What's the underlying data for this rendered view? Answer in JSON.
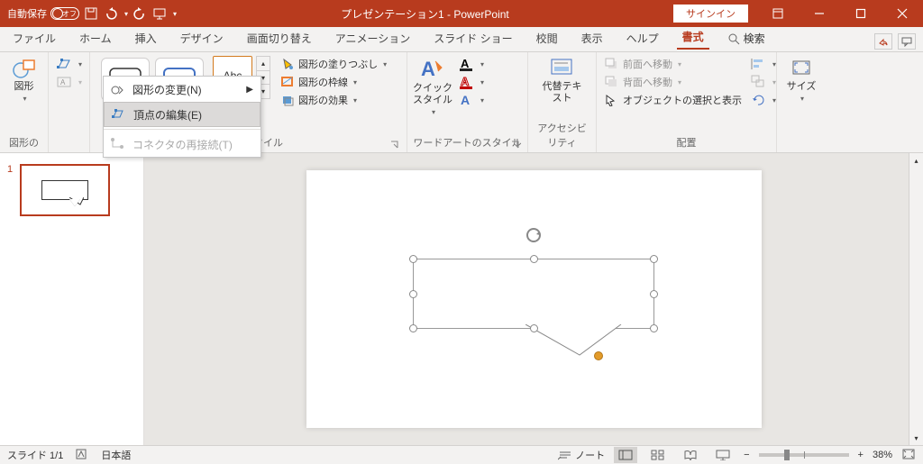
{
  "title_bar": {
    "autosave_label": "自動保存",
    "autosave_state": "オフ",
    "document_title": "プレゼンテーション1 - PowerPoint",
    "sign_in": "サインイン"
  },
  "tabs": {
    "items": [
      "ファイル",
      "ホーム",
      "挿入",
      "デザイン",
      "画面切り替え",
      "アニメーション",
      "スライド ショー",
      "校閲",
      "表示",
      "ヘルプ",
      "書式"
    ],
    "search": "検索",
    "active": "書式"
  },
  "ribbon": {
    "shapes": {
      "label": "図形",
      "group_label": "図形の"
    },
    "styles_group": "図形のスタイル",
    "abc": "Abc",
    "fill": "図形の塗りつぶし",
    "outline": "図形の枠線",
    "effects": "図形の効果",
    "quick_styles": "クイック スタイル",
    "wordart_group": "ワードアートのスタイル",
    "alt_text": "代替テキスト",
    "accessibility_group": "アクセシビリティ",
    "bring_forward": "前面へ移動",
    "send_backward": "背面へ移動",
    "selection_pane": "オブジェクトの選択と表示",
    "arrange_group": "配置",
    "size": "サイズ"
  },
  "context_menu": {
    "change_shape": "図形の変更(N)",
    "edit_points": "頂点の編集(E)",
    "reroute": "コネクタの再接続(T)"
  },
  "thumbnail": {
    "number": "1"
  },
  "status": {
    "slide_counter": "スライド 1/1",
    "language": "日本語",
    "notes": "ノート",
    "zoom": "38%"
  }
}
